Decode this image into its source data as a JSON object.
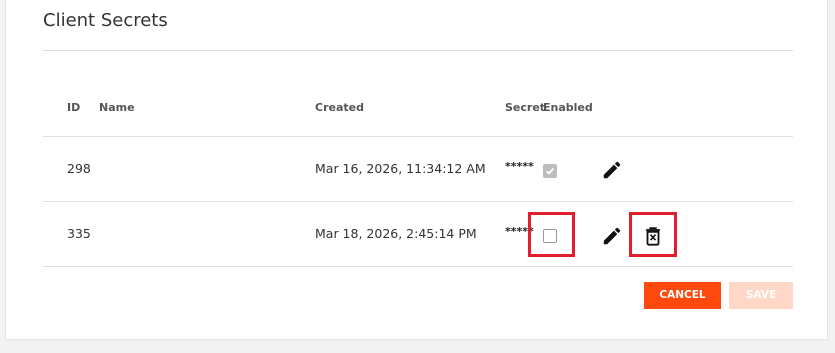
{
  "section": {
    "title": "Client Secrets"
  },
  "table": {
    "headers": {
      "id": "ID",
      "name": "Name",
      "created": "Created",
      "secret": "Secret",
      "enabled": "Enabled"
    },
    "rows": [
      {
        "id": "298",
        "name": "",
        "created": "Mar 16, 2026, 11:34:12 AM",
        "secret": "*****",
        "enabled": true
      },
      {
        "id": "335",
        "name": "",
        "created": "Mar 18, 2026, 2:45:14 PM",
        "secret": "*****",
        "enabled": false
      }
    ]
  },
  "actions": {
    "cancel_label": "CANCEL",
    "save_label": "SAVE"
  },
  "colors": {
    "accent": "#ff4a0f",
    "accent_disabled": "#ffd7c6",
    "highlight": "#e01e2d"
  },
  "icons": {
    "edit": "pencil-icon",
    "delete": "trash-icon",
    "check": "checkmark-icon"
  }
}
